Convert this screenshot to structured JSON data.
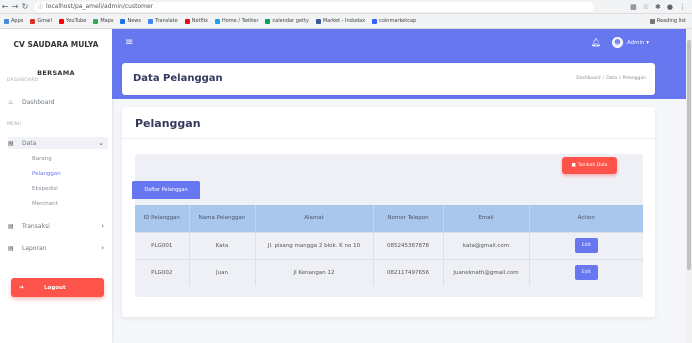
{
  "browser": {
    "url": "localhost/pa_ameli/admin/customer",
    "reading_list": "Reading list",
    "bookmarks": [
      {
        "label": "Apps",
        "color": "#4a89dc"
      },
      {
        "label": "Gmail",
        "color": "#d93025"
      },
      {
        "label": "YouTube",
        "color": "#ff0000"
      },
      {
        "label": "Maps",
        "color": "#34a853"
      },
      {
        "label": "News",
        "color": "#1a73e8"
      },
      {
        "label": "Translate",
        "color": "#4285f4"
      },
      {
        "label": "Netflix",
        "color": "#e50914"
      },
      {
        "label": "Home / Twitter",
        "color": "#1da1f2"
      },
      {
        "label": "calendar getty",
        "color": "#0f9d58"
      },
      {
        "label": "Market - Indodax",
        "color": "#3b5998"
      },
      {
        "label": "coinmarketcap",
        "color": "#3861fb"
      }
    ]
  },
  "sidebar": {
    "brand_line1": "CV SAUDARA MULYA",
    "brand_line2": "BERSAMA",
    "section_dashboard": "DASHBOARD",
    "dashboard": "Dashboard",
    "section_menu": "MENU",
    "data": "Data",
    "sub_items": [
      "Barang",
      "Pelanggan",
      "Ekspedisi",
      "Merchant"
    ],
    "transaksi": "Transaksi",
    "laporan": "Laporan",
    "logout": "Logout"
  },
  "header": {
    "admin": "Admin"
  },
  "page": {
    "title": "Data Pelanggan",
    "breadcrumb": [
      "Dashboard",
      "Data",
      "Pelanggan"
    ]
  },
  "card": {
    "title": "Pelanggan",
    "add_button": "Tambah Data",
    "tab": "Daftar Pelanggan"
  },
  "table": {
    "headers": [
      "ID Pelanggan",
      "Nama Pelanggan",
      "Alamat",
      "Nomor Telepon",
      "Email",
      "Action"
    ],
    "rows": [
      [
        "PLG001",
        "Kata",
        "Jl. pisang mangga 2 blok. K no 10",
        "085245367878",
        "kata@gmail.com",
        "Edit"
      ],
      [
        "PLG002",
        "Juan",
        "Jl Kenangan 12",
        "082117497656",
        "Juaneknath@gmail.com",
        "Edit"
      ]
    ]
  }
}
